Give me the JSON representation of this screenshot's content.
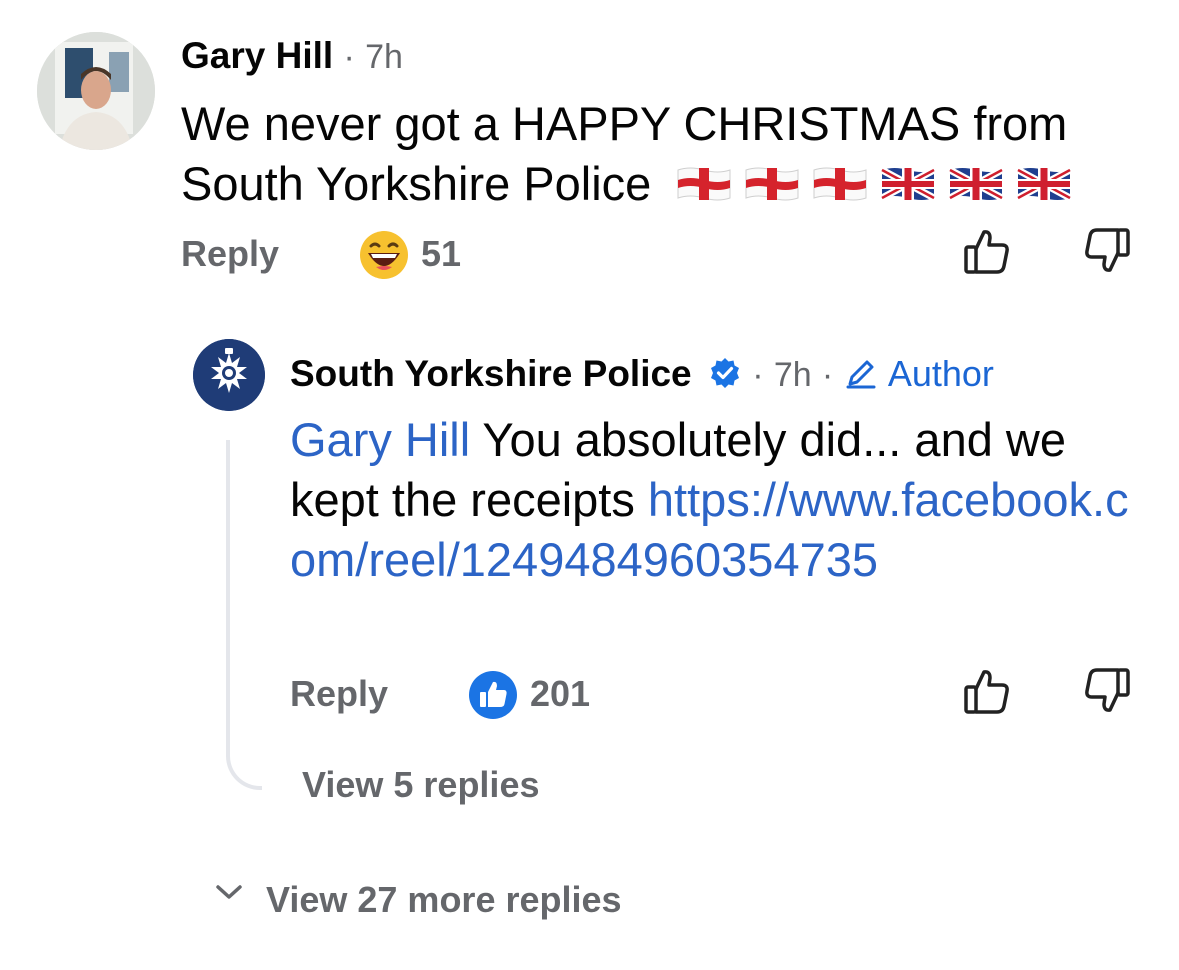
{
  "comment": {
    "author": "Gary Hill",
    "time": "7h",
    "separator": "·",
    "text": "We never got a HAPPY CHRISTMAS from South Yorkshire Police",
    "flags": [
      "england-flag",
      "england-flag",
      "england-flag",
      "union-jack-flag",
      "union-jack-flag",
      "union-jack-flag"
    ],
    "reply_label": "Reply",
    "reaction_icon": "laughing-emoji-icon",
    "reaction_count": "51"
  },
  "reply": {
    "author": "South Yorkshire Police",
    "verified": true,
    "time": "7h",
    "separator": "·",
    "author_badge": "Author",
    "mention": "Gary Hill",
    "text": "You absolutely did... and we kept the receipts",
    "link": "https://www.facebook.com/reel/1249484960354735",
    "reply_label": "Reply",
    "reaction_icon": "like-reaction-icon",
    "reaction_count": "201",
    "view_replies": "View 5 replies"
  },
  "view_more": "View 27 more replies",
  "colors": {
    "text": "#050505",
    "muted": "#65676b",
    "link": "#2c64c6",
    "accent": "#1b74e4",
    "police_blue": "#1f3c77",
    "thread_line": "#e4e6eb"
  }
}
